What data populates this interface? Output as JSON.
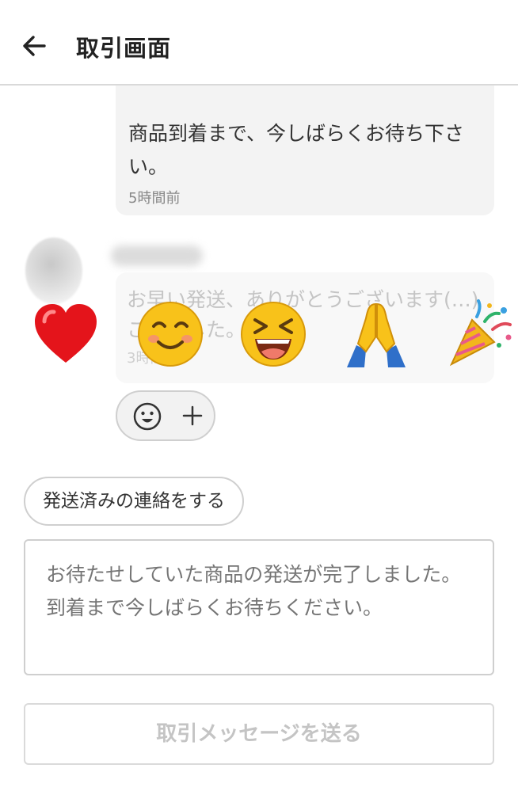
{
  "header": {
    "title": "取引画面",
    "back_icon": "arrow-left-icon"
  },
  "messages": [
    {
      "author": "me",
      "text": "商品到着まで、今しばらくお待ち下さい。",
      "time": "5時間前"
    },
    {
      "author": "other",
      "text": "お早い発送、ありがとうございます(…)こま…した。",
      "time": "3時間前"
    }
  ],
  "reaction_picker": {
    "items": [
      "heart",
      "smiling-face",
      "grinning-squinting-face",
      "folded-hands",
      "party-popper"
    ]
  },
  "reaction_button": {
    "icons": [
      "smile-face-icon",
      "plus-icon"
    ]
  },
  "shipped_button": {
    "label": "発送済みの連絡をする"
  },
  "message_input": {
    "placeholder": "お待たせしていた商品の発送が完了しました。到着まで今しばらくお待ちください。"
  },
  "send_button": {
    "label": "取引メッセージを送る"
  }
}
